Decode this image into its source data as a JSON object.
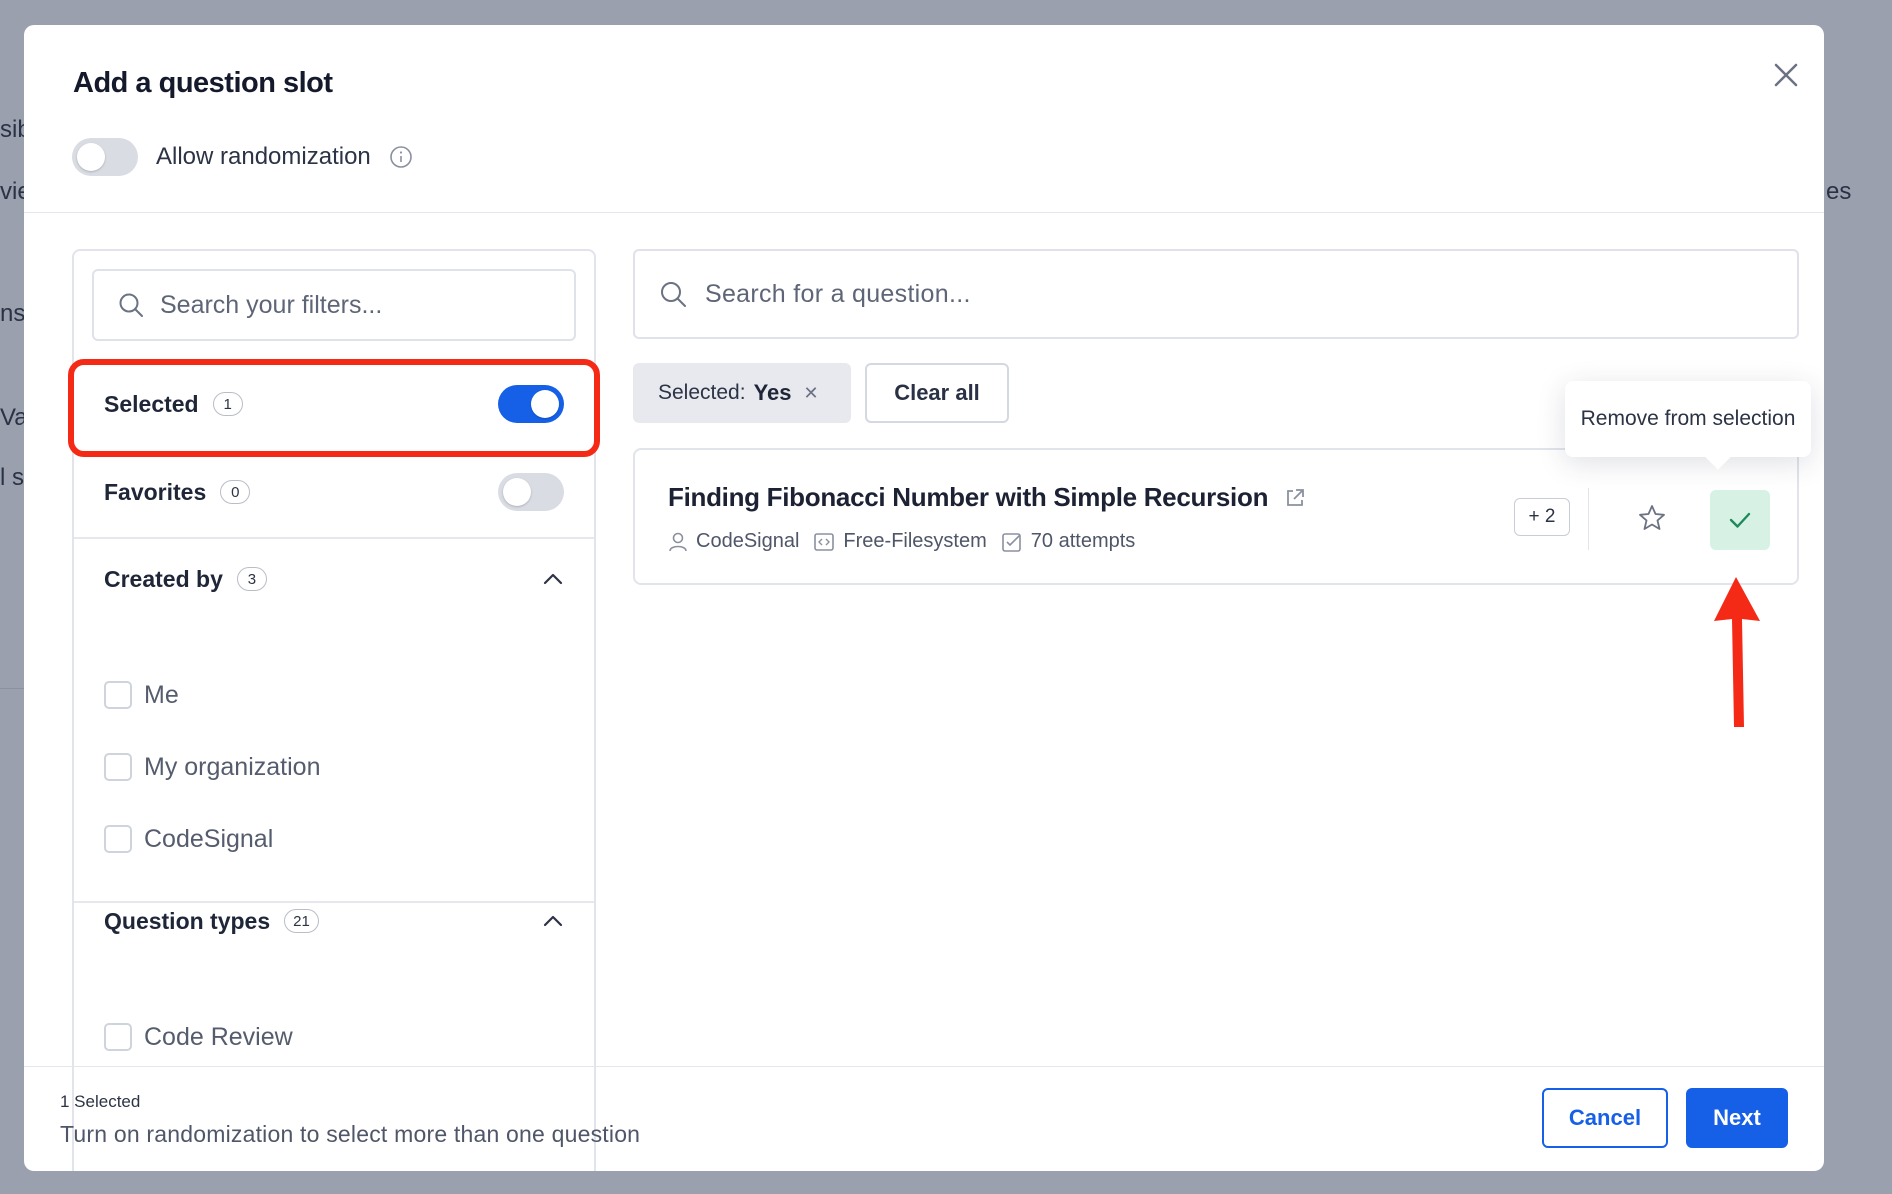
{
  "background": {
    "fragments": [
      "sib",
      "vie",
      "ns",
      "Va",
      "l s",
      "es"
    ]
  },
  "modal": {
    "title": "Add a question slot",
    "close_icon": "close-icon",
    "randomization": {
      "label": "Allow randomization",
      "enabled": false
    }
  },
  "filters": {
    "search_placeholder": "Search your filters...",
    "selected": {
      "label": "Selected",
      "count": "1",
      "enabled": true
    },
    "favorites": {
      "label": "Favorites",
      "count": "0",
      "enabled": false
    },
    "created_by": {
      "label": "Created by",
      "count": "3",
      "expanded": true,
      "options": [
        "Me",
        "My organization",
        "CodeSignal"
      ]
    },
    "question_types": {
      "label": "Question types",
      "count": "21",
      "expanded": true,
      "options": [
        "Code Review"
      ]
    }
  },
  "questions": {
    "search_placeholder": "Search for a question...",
    "active_filter": {
      "key": "Selected:",
      "value": "Yes"
    },
    "clear_all_label": "Clear all",
    "items": [
      {
        "title": "Finding Fibonacci Number with Simple Recursion",
        "author": "CodeSignal",
        "environment": "Free-Filesystem",
        "attempts": "70 attempts",
        "extra_tags": "+ 2",
        "selected": true,
        "favorite": false
      }
    ],
    "tooltip": "Remove from selection"
  },
  "footer": {
    "selected_count": "1 Selected",
    "hint": "Turn on randomization to select more than one question",
    "cancel_label": "Cancel",
    "next_label": "Next"
  },
  "colors": {
    "primary": "#1660e8",
    "selected_green_bg": "#d7f2e4",
    "annotation_red": "#f42a17"
  }
}
